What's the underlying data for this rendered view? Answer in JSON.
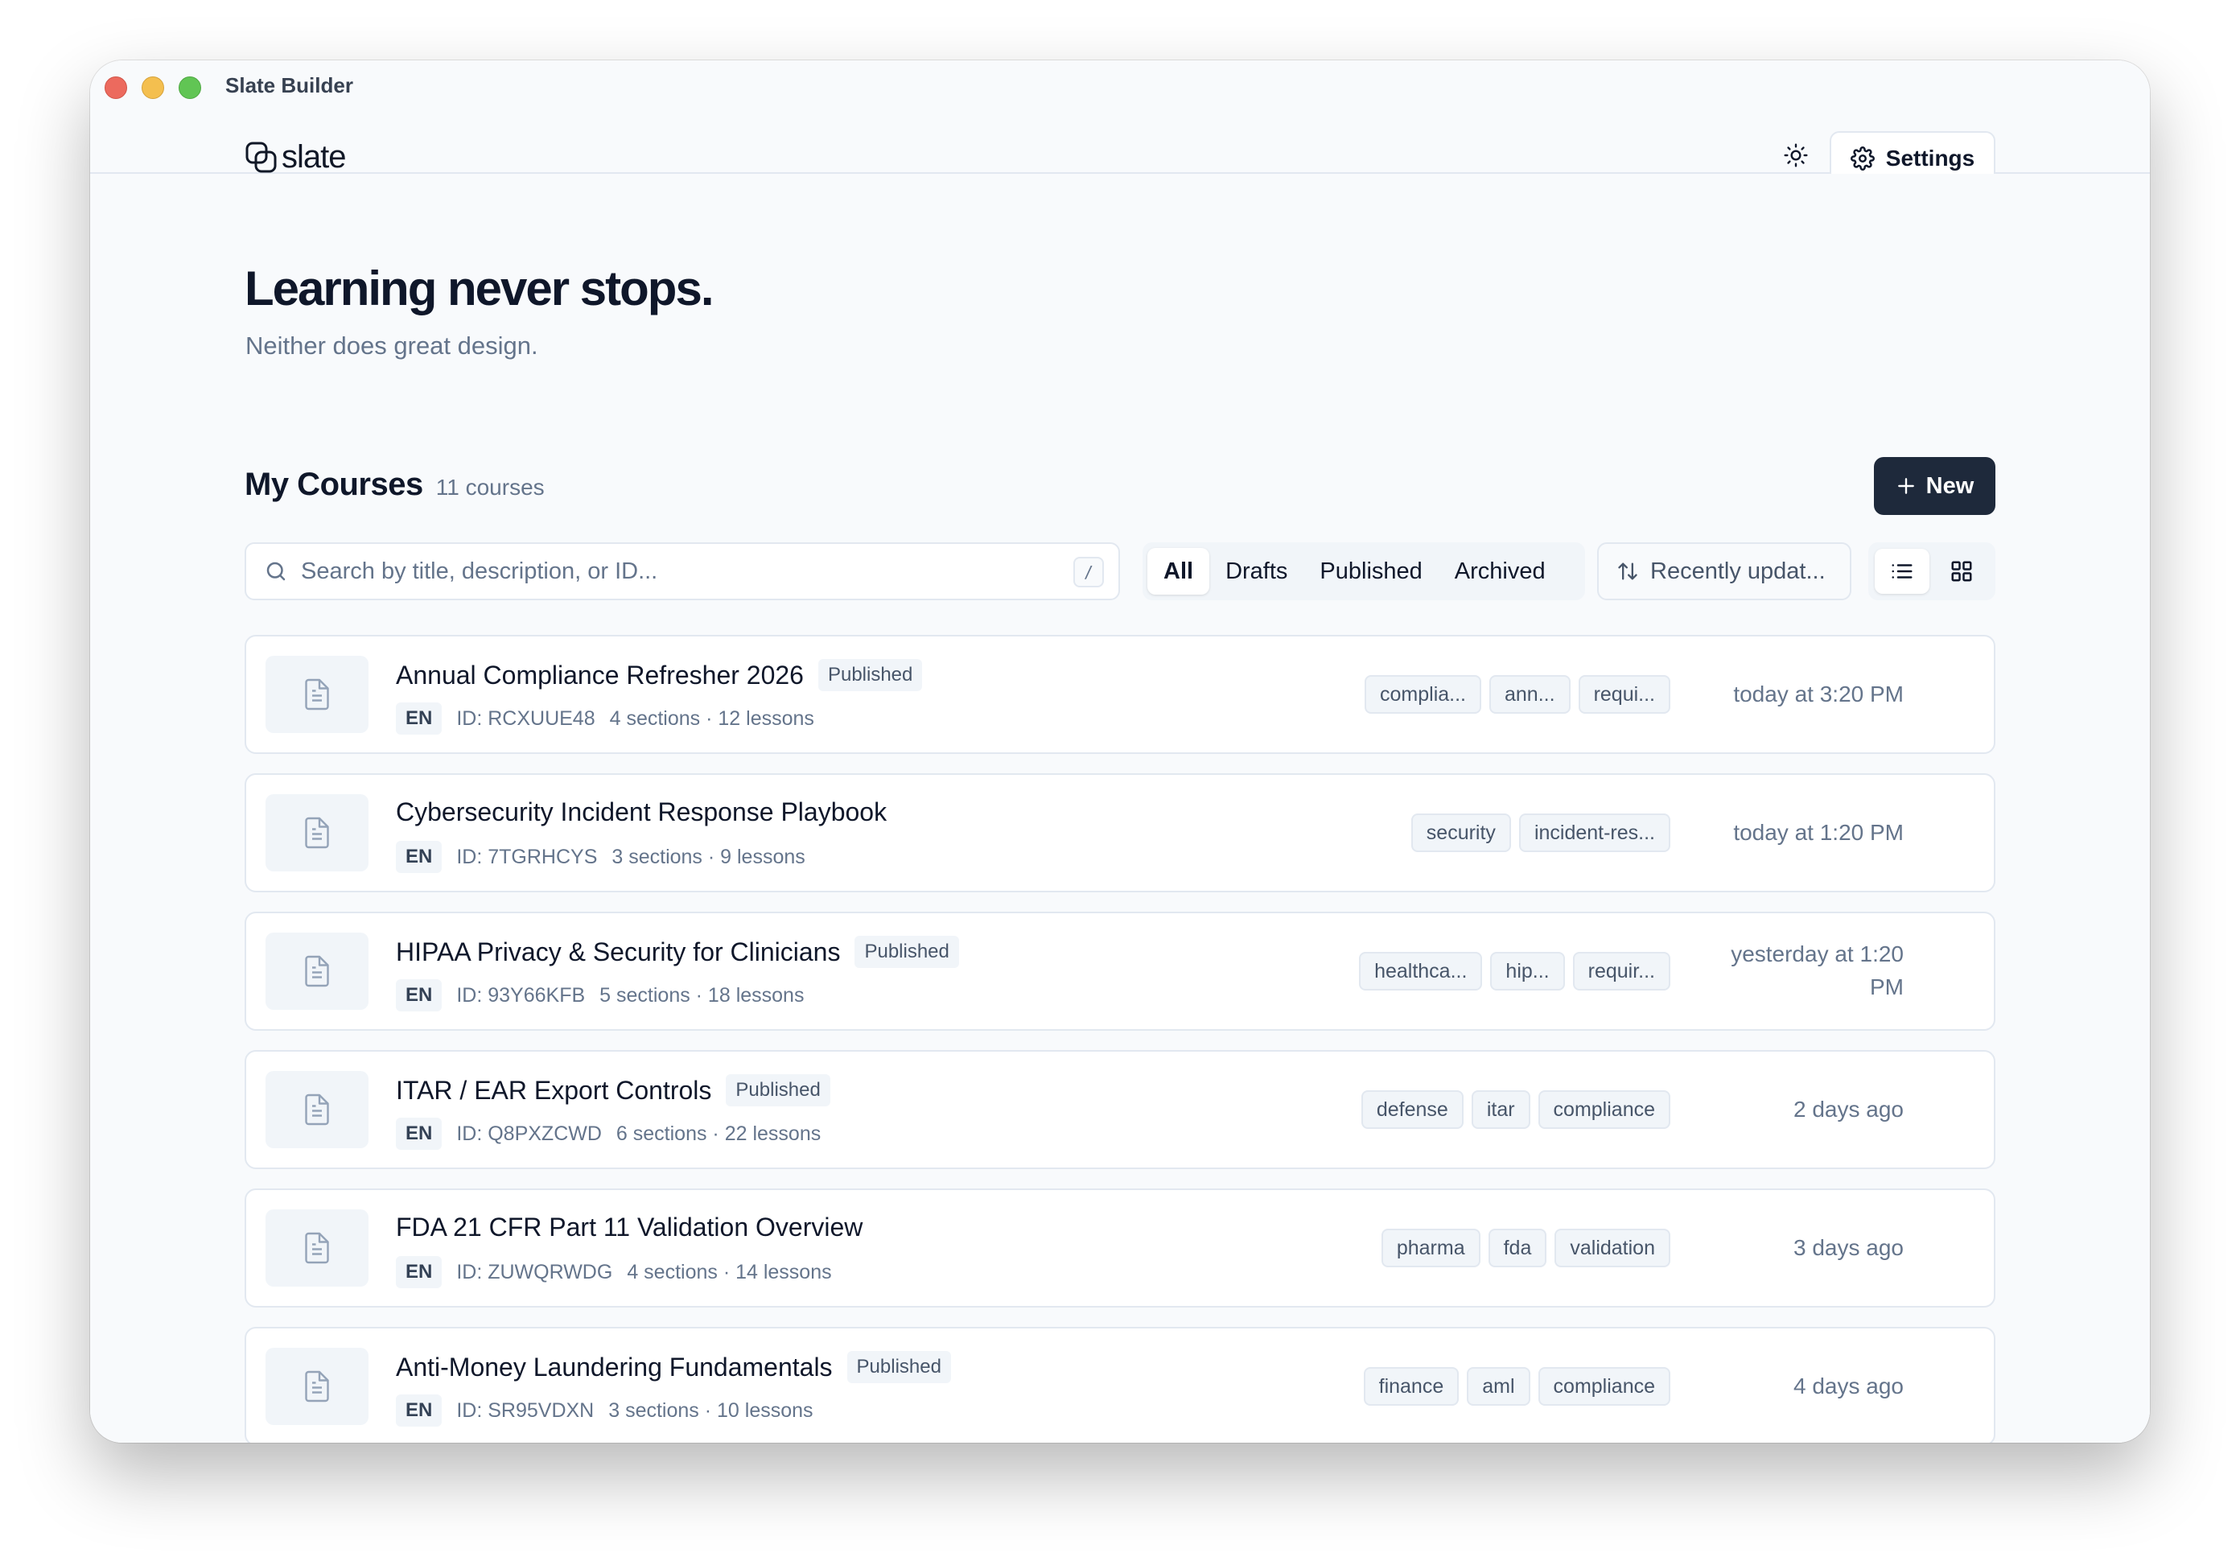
{
  "window": {
    "title": "Slate Builder"
  },
  "header": {
    "logo_text": "slate",
    "settings_label": "Settings",
    "theme_icon": "sun-icon"
  },
  "hero": {
    "title": "Learning never stops.",
    "subtitle": "Neither does great design."
  },
  "courses_section": {
    "title": "My Courses",
    "count": "11 courses",
    "new_label": "New"
  },
  "search": {
    "placeholder": "Search by title, description, or ID...",
    "shortcut": "/"
  },
  "filters": [
    {
      "label": "All",
      "active": true
    },
    {
      "label": "Drafts",
      "active": false
    },
    {
      "label": "Published",
      "active": false
    },
    {
      "label": "Archived",
      "active": false
    }
  ],
  "sort": {
    "label": "Recently updat..."
  },
  "view": {
    "list_icon": "list-icon",
    "grid_icon": "grid-icon",
    "active": "list"
  },
  "courses": [
    {
      "name": "Annual Compliance Refresher 2026",
      "status": "Published",
      "lang": "EN",
      "id": "ID: RCXUUE48",
      "structure": "4 sections · 12 lessons",
      "tags": [
        "complia...",
        "ann...",
        "requi..."
      ],
      "updated": "today at 3:20 PM"
    },
    {
      "name": "Cybersecurity Incident Response Playbook",
      "status": "",
      "lang": "EN",
      "id": "ID: 7TGRHCYS",
      "structure": "3 sections · 9 lessons",
      "tags": [
        "security",
        "incident-res..."
      ],
      "updated": "today at 1:20 PM"
    },
    {
      "name": "HIPAA Privacy & Security for Clinicians",
      "status": "Published",
      "lang": "EN",
      "id": "ID: 93Y66KFB",
      "structure": "5 sections · 18 lessons",
      "tags": [
        "healthca...",
        "hip...",
        "requir..."
      ],
      "updated": "yesterday at 1:20 PM"
    },
    {
      "name": "ITAR / EAR Export Controls",
      "status": "Published",
      "lang": "EN",
      "id": "ID: Q8PXZCWD",
      "structure": "6 sections · 22 lessons",
      "tags": [
        "defense",
        "itar",
        "compliance"
      ],
      "updated": "2 days ago"
    },
    {
      "name": "FDA 21 CFR Part 11 Validation Overview",
      "status": "",
      "lang": "EN",
      "id": "ID: ZUWQRWDG",
      "structure": "4 sections · 14 lessons",
      "tags": [
        "pharma",
        "fda",
        "validation"
      ],
      "updated": "3 days ago"
    },
    {
      "name": "Anti-Money Laundering Fundamentals",
      "status": "Published",
      "lang": "EN",
      "id": "ID: SR95VDXN",
      "structure": "3 sections · 10 lessons",
      "tags": [
        "finance",
        "aml",
        "compliance"
      ],
      "updated": "4 days ago"
    }
  ],
  "colors": {
    "primary_button": "#1e293b",
    "background": "#f8fafc",
    "border": "#e2e8f0",
    "muted_text": "#64748b"
  }
}
